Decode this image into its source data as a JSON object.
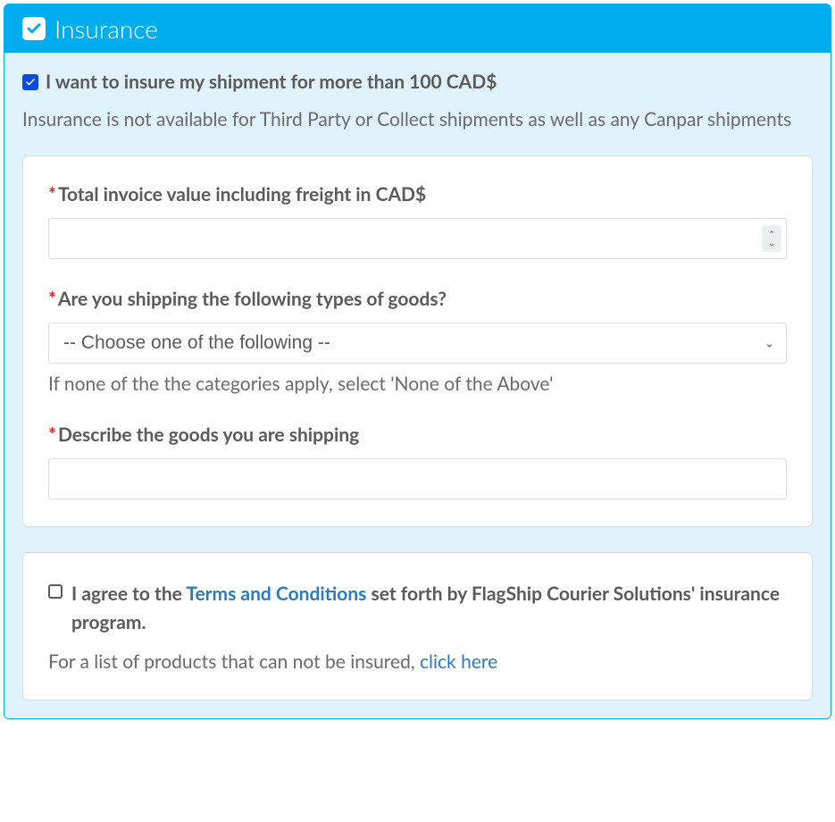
{
  "header": {
    "title": "Insurance"
  },
  "insure": {
    "checked": true,
    "label": "I want to insure my shipment for more than 100 CAD$"
  },
  "disclaimer": "Insurance is not available for Third Party or Collect shipments as well as any Canpar shipments",
  "form": {
    "invoice": {
      "label": "Total invoice value including freight in CAD$",
      "value": ""
    },
    "goods_type": {
      "label": "Are you shipping the following types of goods?",
      "selected": "-- Choose one of the following --",
      "helper": "If none of the the categories apply, select 'None of the Above'"
    },
    "describe": {
      "label": "Describe the goods you are shipping",
      "value": ""
    }
  },
  "agree": {
    "checked": false,
    "pre": "I agree to the ",
    "link": "Terms and Conditions",
    "post": " set forth by FlagShip Courier Solutions' insurance program."
  },
  "products": {
    "pre": "For a list of products that can not be insured, ",
    "link": "click here"
  }
}
